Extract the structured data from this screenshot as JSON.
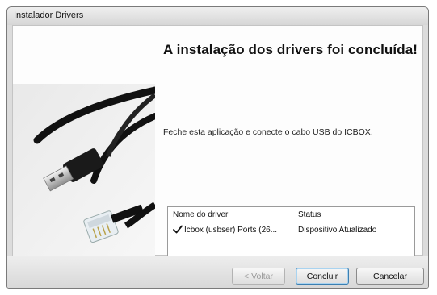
{
  "window": {
    "title": "Instalador Drivers"
  },
  "main": {
    "heading": "A instalação dos drivers foi concluída!",
    "message": "Feche esta aplicação e conecte o cabo USB do ICBOX."
  },
  "driver_list": {
    "columns": [
      "Nome do driver",
      "Status"
    ],
    "rows": [
      {
        "name": "Icbox (usbser) Ports  (26...",
        "status": "Dispositivo Atualizado",
        "icon": "checkmark-icon"
      }
    ]
  },
  "buttons": {
    "back_label": "< Voltar",
    "finish_label": "Concluir",
    "cancel_label": "Cancelar"
  }
}
